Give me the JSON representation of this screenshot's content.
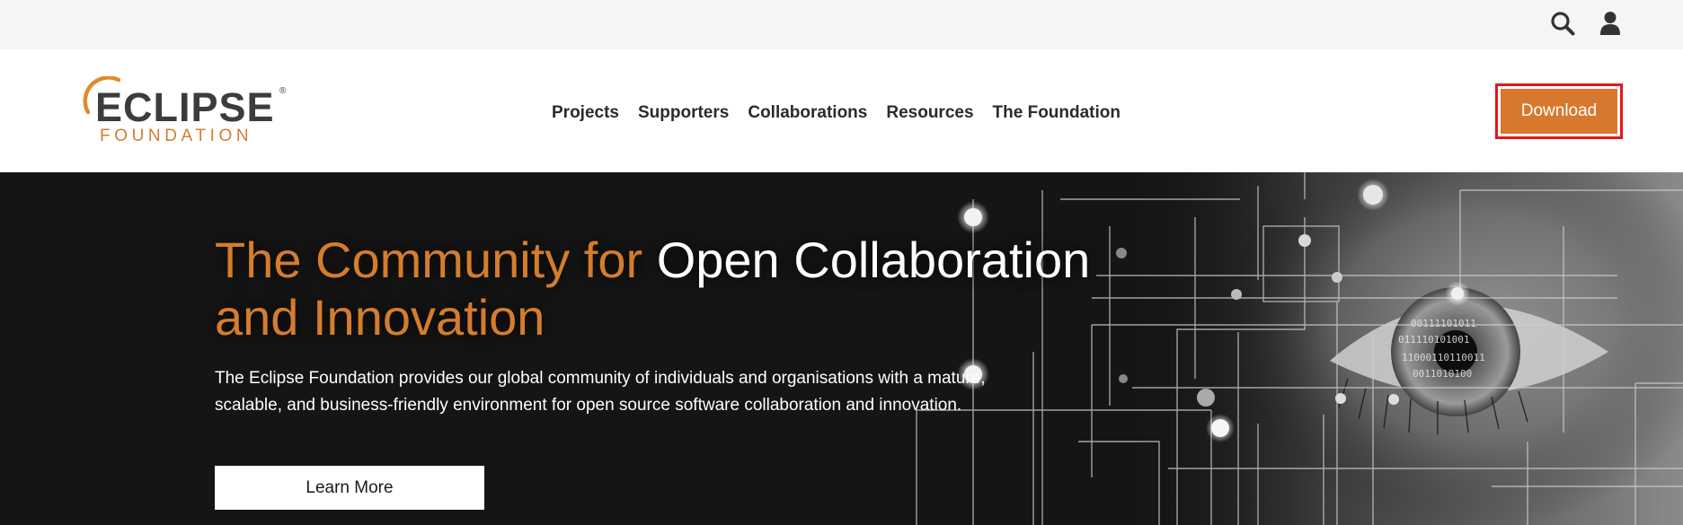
{
  "utility_bar": {
    "search_icon": "search-icon",
    "user_icon": "user-icon"
  },
  "logo": {
    "wordmark": "ECLIPSE",
    "registered": "®",
    "subtitle": "FOUNDATION"
  },
  "nav": {
    "items": [
      {
        "label": "Projects"
      },
      {
        "label": "Supporters"
      },
      {
        "label": "Collaborations"
      },
      {
        "label": "Resources"
      },
      {
        "label": "The Foundation"
      }
    ]
  },
  "header": {
    "download_label": "Download"
  },
  "hero": {
    "title_part1": "The Community for ",
    "title_part2": "Open Collaboration",
    "title_part3": "and Innovation",
    "description": "The Eclipse Foundation provides our global community of individuals and organisations with a mature, scalable, and business-friendly environment for open source software collaboration and innovation.",
    "learn_more_label": "Learn More"
  },
  "colors": {
    "brand_orange": "#d47d2d",
    "download_bg": "#d8782e",
    "highlight_border": "#e3171d",
    "hero_bg": "#151515"
  }
}
